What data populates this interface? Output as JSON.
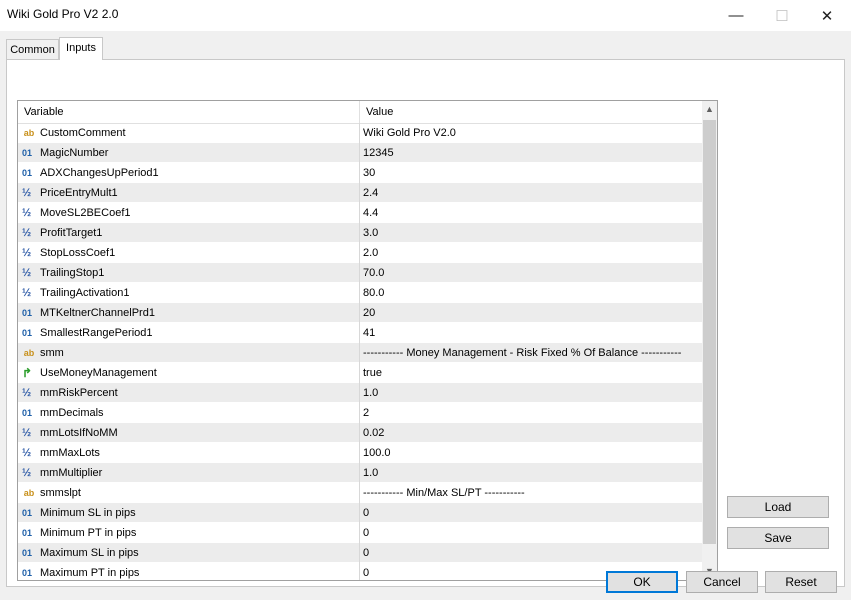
{
  "window": {
    "title": "Wiki Gold Pro V2 2.0",
    "minimize_glyph": "—",
    "maximize_glyph": "☐",
    "close_glyph": "✕"
  },
  "tabs": [
    {
      "label": "Common",
      "active": false
    },
    {
      "label": "Inputs",
      "active": true
    }
  ],
  "grid": {
    "columns": [
      "Variable",
      "Value"
    ],
    "rows": [
      {
        "type_icon": "ab",
        "icon_name": "string-type-icon",
        "variable": "CustomComment",
        "value": "Wiki Gold Pro V2.0"
      },
      {
        "type_icon": "01",
        "icon_name": "integer-type-icon",
        "variable": "MagicNumber",
        "value": "12345"
      },
      {
        "type_icon": "01",
        "icon_name": "integer-type-icon",
        "variable": "ADXChangesUpPeriod1",
        "value": "30"
      },
      {
        "type_icon": "½",
        "icon_name": "double-type-icon",
        "variable": "PriceEntryMult1",
        "value": "2.4"
      },
      {
        "type_icon": "½",
        "icon_name": "double-type-icon",
        "variable": "MoveSL2BECoef1",
        "value": "4.4"
      },
      {
        "type_icon": "½",
        "icon_name": "double-type-icon",
        "variable": "ProfitTarget1",
        "value": "3.0"
      },
      {
        "type_icon": "½",
        "icon_name": "double-type-icon",
        "variable": "StopLossCoef1",
        "value": "2.0"
      },
      {
        "type_icon": "½",
        "icon_name": "double-type-icon",
        "variable": "TrailingStop1",
        "value": "70.0"
      },
      {
        "type_icon": "½",
        "icon_name": "double-type-icon",
        "variable": "TrailingActivation1",
        "value": "80.0"
      },
      {
        "type_icon": "01",
        "icon_name": "integer-type-icon",
        "variable": "MTKeltnerChannelPrd1",
        "value": "20"
      },
      {
        "type_icon": "01",
        "icon_name": "integer-type-icon",
        "variable": "SmallestRangePeriod1",
        "value": "41"
      },
      {
        "type_icon": "ab",
        "icon_name": "string-type-icon",
        "variable": "smm",
        "value": "----------- Money Management - Risk Fixed % Of Balance -----------"
      },
      {
        "type_icon": "↱",
        "icon_name": "boolean-type-icon",
        "variable": "UseMoneyManagement",
        "value": "true"
      },
      {
        "type_icon": "½",
        "icon_name": "double-type-icon",
        "variable": "mmRiskPercent",
        "value": "1.0"
      },
      {
        "type_icon": "01",
        "icon_name": "integer-type-icon",
        "variable": "mmDecimals",
        "value": "2"
      },
      {
        "type_icon": "½",
        "icon_name": "double-type-icon",
        "variable": "mmLotsIfNoMM",
        "value": "0.02"
      },
      {
        "type_icon": "½",
        "icon_name": "double-type-icon",
        "variable": "mmMaxLots",
        "value": "100.0"
      },
      {
        "type_icon": "½",
        "icon_name": "double-type-icon",
        "variable": "mmMultiplier",
        "value": "1.0"
      },
      {
        "type_icon": "ab",
        "icon_name": "string-type-icon",
        "variable": "smmslpt",
        "value": "----------- Min/Max SL/PT -----------"
      },
      {
        "type_icon": "01",
        "icon_name": "integer-type-icon",
        "variable": "Minimum SL in pips",
        "value": "0"
      },
      {
        "type_icon": "01",
        "icon_name": "integer-type-icon",
        "variable": "Minimum PT in pips",
        "value": "0"
      },
      {
        "type_icon": "01",
        "icon_name": "integer-type-icon",
        "variable": "Maximum SL in pips",
        "value": "0"
      },
      {
        "type_icon": "01",
        "icon_name": "integer-type-icon",
        "variable": "Maximum PT in pips",
        "value": "0"
      }
    ]
  },
  "side_buttons": {
    "load": "Load",
    "save": "Save"
  },
  "footer_buttons": {
    "ok": "OK",
    "cancel": "Cancel",
    "reset": "Reset"
  },
  "colors": {
    "ok_border": "#0078d7",
    "alt_row": "#ececec"
  }
}
